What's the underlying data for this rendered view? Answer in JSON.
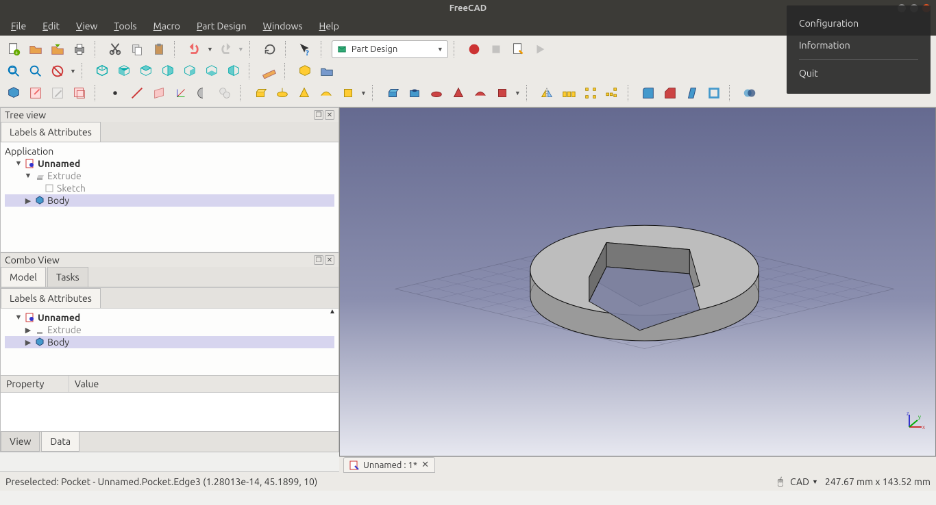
{
  "window": {
    "title": "FreeCAD"
  },
  "menu": {
    "items": [
      "File",
      "Edit",
      "View",
      "Tools",
      "Macro",
      "Part Design",
      "Windows",
      "Help"
    ]
  },
  "popup": {
    "items": [
      "Configuration",
      "Information"
    ],
    "quit_label": "Quit"
  },
  "workbench": {
    "selected": "Part Design"
  },
  "panels": {
    "tree_title": "Tree view",
    "combo_title": "Combo View",
    "labels_tab": "Labels & Attributes",
    "model_tab": "Model",
    "tasks_tab": "Tasks",
    "view_tab": "View",
    "data_tab": "Data",
    "application": "Application",
    "property_col": "Property",
    "value_col": "Value",
    "doc": "Unnamed",
    "extrude": "Extrude",
    "sketch": "Sketch",
    "body": "Body"
  },
  "doc_tab": {
    "label": "Unnamed : 1*"
  },
  "status": {
    "left": "Preselected: Pocket - Unnamed.Pocket.Edge3 (1.28013e-14, 45.1899, 10)",
    "nav": "CAD",
    "dims": "247.67 mm x 143.52 mm"
  }
}
